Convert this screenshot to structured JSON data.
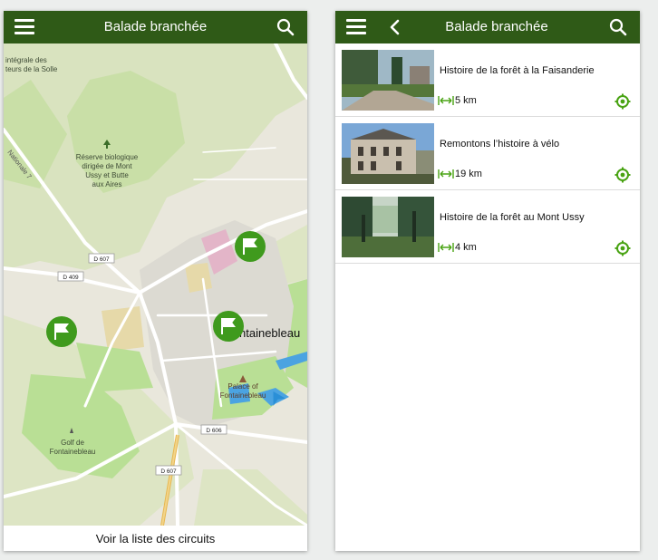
{
  "colors": {
    "app_bar": "#2f5a17",
    "accent_green": "#49a313",
    "marker_green": "#3f9a1d"
  },
  "left_screen": {
    "app_title": "Balade branchée",
    "icons": {
      "menu": "hamburger-menu-icon",
      "search": "search-icon"
    },
    "map": {
      "labels": {
        "reserve_top_1": "intégrale des",
        "reserve_top_2": "teurs de la Solle",
        "nationale": "Nationale 7",
        "reserve_1": "Réserve biologique",
        "reserve_2": "dirigée de Mont",
        "reserve_3": "Ussy et Butte",
        "reserve_4": "aux Aires",
        "road_d607_top": "D 607",
        "road_d409": "D 409",
        "town": "ntainebleau",
        "palace_1": "Palace of",
        "palace_2": "Fontainebleau",
        "road_d606": "D 606",
        "golf_1": "Golf de",
        "golf_2": "Fontainebleau",
        "road_d607_bottom": "D 607"
      },
      "markers": [
        {
          "icon": "flag-icon"
        },
        {
          "icon": "flag-icon"
        },
        {
          "icon": "flag-icon"
        }
      ]
    },
    "bottom_button": "Voir la liste des circuits"
  },
  "right_screen": {
    "app_title": "Balade branchée",
    "icons": {
      "menu": "hamburger-menu-icon",
      "back": "back-arrow-icon",
      "search": "search-icon"
    },
    "circuits": [
      {
        "title": "Histoire de la forêt à la Faisanderie",
        "distance": "5 km",
        "thumb": "forest-road-photo"
      },
      {
        "title": "Remontons l’histoire à vélo",
        "distance": "19 km",
        "thumb": "chateau-building-photo"
      },
      {
        "title": "Histoire de la forêt au Mont Ussy",
        "distance": "4 km",
        "thumb": "forest-clearing-photo"
      }
    ]
  }
}
